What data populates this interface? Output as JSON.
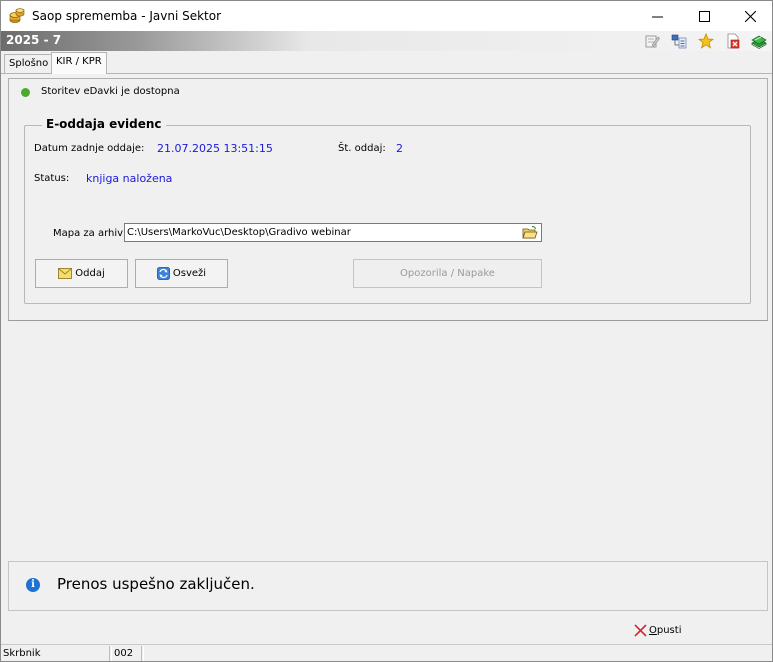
{
  "window": {
    "title": "Saop sprememba - Javni Sektor",
    "controls": {
      "minimize": "–",
      "maximize": "☐",
      "close": "✕"
    }
  },
  "header": {
    "period": "2025 - 7",
    "toolbar_icons": [
      "edit-icon",
      "organization-icon",
      "favorite-star-icon",
      "close-document-icon",
      "books-icon"
    ]
  },
  "tabs": [
    {
      "label": "Splošno",
      "active": false
    },
    {
      "label": "KIR / KPR",
      "active": true
    }
  ],
  "service_status": {
    "text": "Storitev eDavki je dostopna",
    "color": "#4caa2c"
  },
  "group": {
    "title": "E-oddaja evidenc",
    "last_submission_label": "Datum zadnje oddaje:",
    "last_submission_value": "21.07.2025 13:51:15",
    "submissions_count_label": "Št. oddaj:",
    "submissions_count_value": "2",
    "status_label": "Status:",
    "status_value": "knjiga naložena",
    "archive_label": "Mapa za arhiv",
    "archive_path": "C:\\Users\\MarkoVuc\\Desktop\\Gradivo webinar",
    "buttons": {
      "submit": "Oddaj",
      "refresh": "Osveži",
      "warnings": "Opozorila / Napake"
    }
  },
  "info": {
    "message": "Prenos uspešno zaključen."
  },
  "footer": {
    "cancel_label": "Opusti",
    "cancel_mnemonic": "O",
    "cancel_rest": "pusti"
  },
  "statusbar": {
    "user": "Skrbnik",
    "code": "002"
  },
  "colors": {
    "value_text": "#1a1adc",
    "info_icon": "#1e73d2",
    "status_green": "#4caa2c"
  }
}
